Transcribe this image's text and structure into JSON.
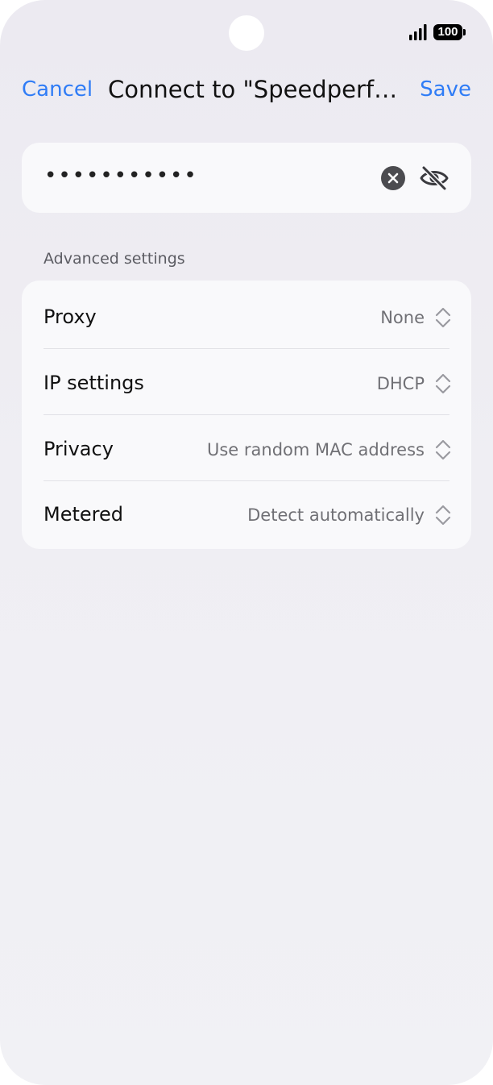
{
  "status_bar": {
    "battery": "100"
  },
  "header": {
    "cancel_label": "Cancel",
    "title": "Connect to \"Speedperfor...",
    "save_label": "Save"
  },
  "password": {
    "value": "•••••••••••"
  },
  "advanced": {
    "section_label": "Advanced settings",
    "rows": [
      {
        "label": "Proxy",
        "value": "None"
      },
      {
        "label": "IP settings",
        "value": "DHCP"
      },
      {
        "label": "Privacy",
        "value": "Use random MAC address"
      },
      {
        "label": "Metered",
        "value": "Detect automatically"
      }
    ]
  },
  "colors": {
    "accent": "#2f7cf6",
    "background": "#eeedf2",
    "card": "#f9f9fb"
  },
  "icons": [
    "signal-icon",
    "battery-icon",
    "clear-icon",
    "eye-off-icon",
    "stepper-icon"
  ]
}
